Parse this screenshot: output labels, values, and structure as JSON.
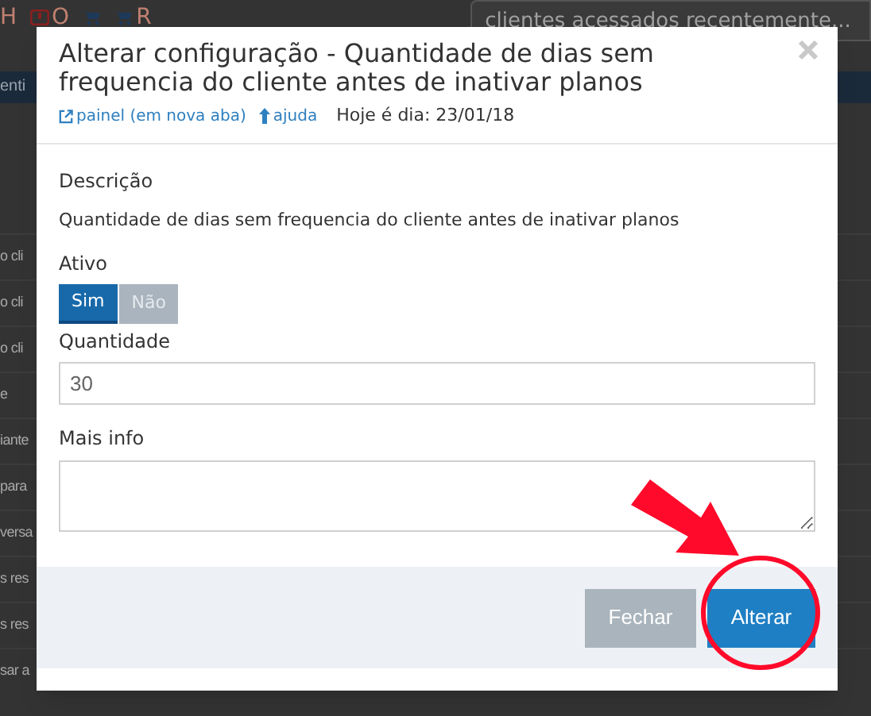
{
  "background": {
    "top_items": [
      {
        "kind": "letter",
        "label": "H"
      },
      {
        "kind": "alert",
        "label": "O"
      },
      {
        "kind": "cart"
      },
      {
        "kind": "cart",
        "label": "R"
      }
    ],
    "recent_search": "clientes acessados recentemente...",
    "header_fragment": "enti",
    "rows": [
      "o cli",
      "o cli",
      "o cli",
      "e",
      "iante",
      "para",
      "versa",
      "s res",
      "s res",
      "sar a"
    ]
  },
  "modal": {
    "title": "Alterar configuração - Quantidade de dias sem frequencia do cliente antes de inativar planos",
    "links": [
      {
        "kind": "external",
        "label": "painel (em nova aba)"
      },
      {
        "kind": "help",
        "label": "ajuda"
      }
    ],
    "date": "Hoje é dia: 23/01/18",
    "description_label": "Descrição",
    "description": "Quantidade de dias sem frequencia do cliente antes de inativar planos",
    "active_label": "Ativo",
    "active_options": [
      {
        "label": "Sim",
        "selected": true
      },
      {
        "label": "Não",
        "selected": false
      }
    ],
    "quantity_label": "Quantidade",
    "quantity_value": "30",
    "info_label": "Mais info",
    "buttons": [
      {
        "kind": "secondary",
        "label": "Fechar"
      },
      {
        "kind": "primary",
        "label": "Alterar"
      }
    ]
  }
}
